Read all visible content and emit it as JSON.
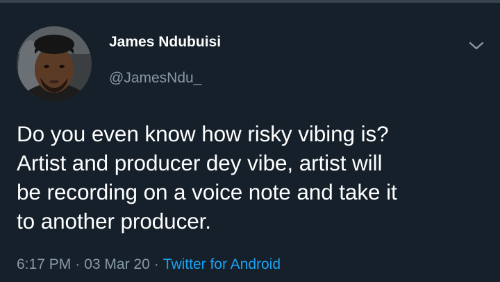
{
  "tweet": {
    "author": {
      "display_name": "James Ndubuisi",
      "handle": "@JamesNdu_"
    },
    "text_lines": [
      "Do you even know how risky vibing is?",
      "Artist and producer dey vibe, artist will",
      "be recording on a voice note and take it",
      "to another producer."
    ],
    "meta": {
      "time": "6:17 PM",
      "separator": "·",
      "date": "03 Mar 20",
      "source": "Twitter for Android"
    }
  },
  "icons": {
    "more_menu": "chevron-down-icon"
  },
  "colors": {
    "background": "#15202b",
    "primary_text": "#ffffff",
    "secondary_text": "#8899a6",
    "link": "#1da1f2",
    "divider": "#38444d"
  }
}
